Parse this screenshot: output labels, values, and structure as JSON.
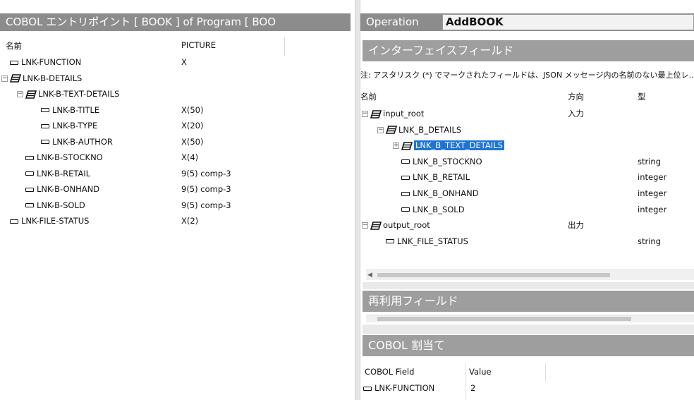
{
  "left_panel": {
    "title": "COBOL エントリポイント [ BOOK ] of Program [ BOO",
    "columns": {
      "name": "名前",
      "picture": "PICTURE"
    },
    "rows": [
      {
        "name": "LNK-FUNCTION",
        "picture": "X",
        "kind": "field",
        "level": 0
      },
      {
        "name": "LNK-B-DETAILS",
        "picture": "",
        "kind": "group",
        "level": 0,
        "expander": "−"
      },
      {
        "name": "LNK-B-TEXT-DETAILS",
        "picture": "",
        "kind": "group",
        "level": 1,
        "expander": "−"
      },
      {
        "name": "LNK-B-TITLE",
        "picture": "X(50)",
        "kind": "field",
        "level": 2
      },
      {
        "name": "LNK-B-TYPE",
        "picture": "X(20)",
        "kind": "field",
        "level": 2
      },
      {
        "name": "LNK-B-AUTHOR",
        "picture": "X(50)",
        "kind": "field",
        "level": 2
      },
      {
        "name": "LNK-B-STOCKNO",
        "picture": "X(4)",
        "kind": "field",
        "level": 1
      },
      {
        "name": "LNK-B-RETAIL",
        "picture": "9(5) comp-3",
        "kind": "field",
        "level": 1
      },
      {
        "name": "LNK-B-ONHAND",
        "picture": "9(5) comp-3",
        "kind": "field",
        "level": 1
      },
      {
        "name": "LNK-B-SOLD",
        "picture": "9(5) comp-3",
        "kind": "field",
        "level": 1
      },
      {
        "name": "LNK-FILE-STATUS",
        "picture": "X(2)",
        "kind": "field",
        "level": 0
      }
    ]
  },
  "operation": {
    "label": "Operation",
    "value": "AddBOOK"
  },
  "interface_fields": {
    "title": "インターフェイスフィールド",
    "note": "注: アスタリスク (*) でマークされたフィールドは、JSON メッセージ内の名前のない最上位レ...",
    "columns": {
      "name": "名前",
      "direction": "方向",
      "type": "型"
    },
    "rows": [
      {
        "name": "input_root",
        "direction": "入力",
        "type": "",
        "kind": "group",
        "level": 0,
        "expander": "−"
      },
      {
        "name": "LNK_B_DETAILS",
        "direction": "",
        "type": "",
        "kind": "group",
        "level": 1,
        "expander": "−"
      },
      {
        "name": "LNK_B_TEXT_DETAILS",
        "direction": "",
        "type": "",
        "kind": "group",
        "level": 2,
        "expander": "+",
        "selected": true
      },
      {
        "name": "LNK_B_STOCKNO",
        "direction": "",
        "type": "string",
        "kind": "field",
        "level": 2
      },
      {
        "name": "LNK_B_RETAIL",
        "direction": "",
        "type": "integer",
        "kind": "field",
        "level": 2
      },
      {
        "name": "LNK_B_ONHAND",
        "direction": "",
        "type": "integer",
        "kind": "field",
        "level": 2
      },
      {
        "name": "LNK_B_SOLD",
        "direction": "",
        "type": "integer",
        "kind": "field",
        "level": 2
      },
      {
        "name": "output_root",
        "direction": "出力",
        "type": "",
        "kind": "group",
        "level": 0,
        "expander": "−"
      },
      {
        "name": "LNK_FILE_STATUS",
        "direction": "",
        "type": "string",
        "kind": "field",
        "level": 1
      }
    ]
  },
  "reuse_fields": {
    "title": "再利用フィールド"
  },
  "cobol_assign": {
    "title": "COBOL 割当て",
    "columns": {
      "field": "COBOL Field",
      "value": "Value"
    },
    "rows": [
      {
        "field": "LNK-FUNCTION",
        "value": "2"
      }
    ]
  },
  "colors": {
    "header_gray": "#8c8c8c",
    "panel_gray": "#9e9e9e",
    "selection": "#1e74d4"
  }
}
